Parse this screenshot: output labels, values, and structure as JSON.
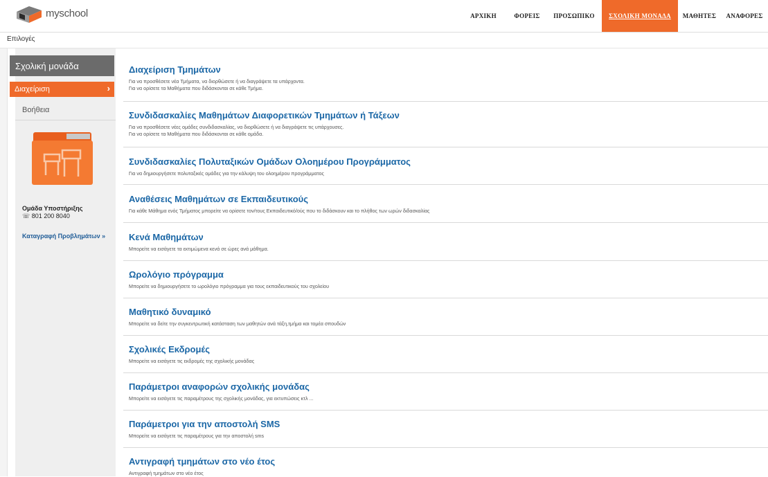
{
  "header": {
    "logo_text": "myschool",
    "nav": [
      {
        "label": "ΑΡΧΙΚΗ",
        "active": false
      },
      {
        "label": "ΦΟΡΕΙΣ",
        "active": false
      },
      {
        "label": "ΠΡΟΣΩΠΙΚΟ",
        "active": false
      },
      {
        "label": "ΣΧΟΛΙΚΗ ΜΟΝΑΔΑ",
        "active": true
      },
      {
        "label": "ΜΑΘΗΤΕΣ",
        "active": false
      },
      {
        "label": "ΑΝΑΦΟΡΕΣ",
        "active": false
      }
    ]
  },
  "subbar": {
    "label": "Επιλογές"
  },
  "sidebar": {
    "title": "Σχολική μονάδα",
    "manage": "Διαχείριση",
    "help": "Βοήθεια",
    "support_title": "Ομάδα Υποστήριξης",
    "support_phone": "801 200 8040",
    "problems_link": "Καταγραφή Προβλημάτων »"
  },
  "entries": [
    {
      "title": "Διαχείριση Τμημάτων",
      "desc": [
        "Για να προσθέσετε νέα Τμήματα, να διορθώσετε ή να διαγράψετε τα υπάρχοντα.",
        "Για να ορίσετε τα Μαθήματα που διδάσκονται σε κάθε Τμήμα."
      ]
    },
    {
      "title": "Συνδιδασκαλίες Μαθημάτων Διαφορετικών Τμημάτων ή Τάξεων",
      "desc": [
        "Για να προσθέσετε νέες ομάδες συνδιδασκαλίας, να διορθώσετε ή να διαγράψετε τις υπάρχουσες.",
        "Για να ορίσετε τα Μαθήματα που διδάσκονται σε κάθε ομάδα."
      ]
    },
    {
      "title": "Συνδιδασκαλίες Πολυταξικών Ομάδων Ολοημέρου Προγράμματος",
      "desc": [
        "Για να δημιουργήσετε πολυταξικές ομάδες για την κάλυψη του ολοημέρου προγράμματος"
      ]
    },
    {
      "title": "Αναθέσεις Μαθημάτων σε Εκπαιδευτικούς",
      "desc": [
        "Για κάθε Μάθημα ενός Τμήματος μπορείτε να ορίσετε τον/τους Εκπαιδευτικό/ούς που το διδάσκουν και το πλήθος των ωρών διδασκαλίας"
      ]
    },
    {
      "title": "Κενά Μαθημάτων",
      "desc": [
        "Μπορείτε να εισάγετε τα εκτιμώμενα κενά σε ώρες ανά μάθημα."
      ]
    },
    {
      "title": "Ωρολόγιο πρόγραμμα",
      "desc": [
        "Μπορείτε να δημιουργήσετε το ωρολόγιο πρόγραμμα για τους εκπαιδευτικούς του σχολείου"
      ]
    },
    {
      "title": "Μαθητικό δυναμικό",
      "desc": [
        "Μπορείτε να δείτε την συγκεντρωτική κατάσταση των μαθητών ανά τάξη,τμήμα και τομέα σπουδών"
      ]
    },
    {
      "title": "Σχολικές Εκδρομές",
      "desc": [
        "Μπορείτε να εισάγετε τις εκδρομές της σχολικής μονάδας"
      ]
    },
    {
      "title": "Παράμετροι αναφορών σχολικής μονάδας",
      "desc": [
        "Μπορείτε να εισάγετε τις παραμέτρους της σχολικής μονάδας, για εκτυπώσεις κτλ ..."
      ]
    },
    {
      "title": "Παράμετροι για την αποστολή SMS",
      "desc": [
        "Μπορείτε να εισάγετε τις παραμέτρους για την αποστολή sms"
      ]
    },
    {
      "title": "Αντιγραφή τμημάτων στο νέο έτος",
      "desc": [
        "Αντιγραφή τμημάτων στο νέο έτος"
      ]
    }
  ],
  "colors": {
    "accent": "#ef6a2a",
    "link": "#1b67a6",
    "sidebar_title_bg": "#6b6b6b"
  }
}
